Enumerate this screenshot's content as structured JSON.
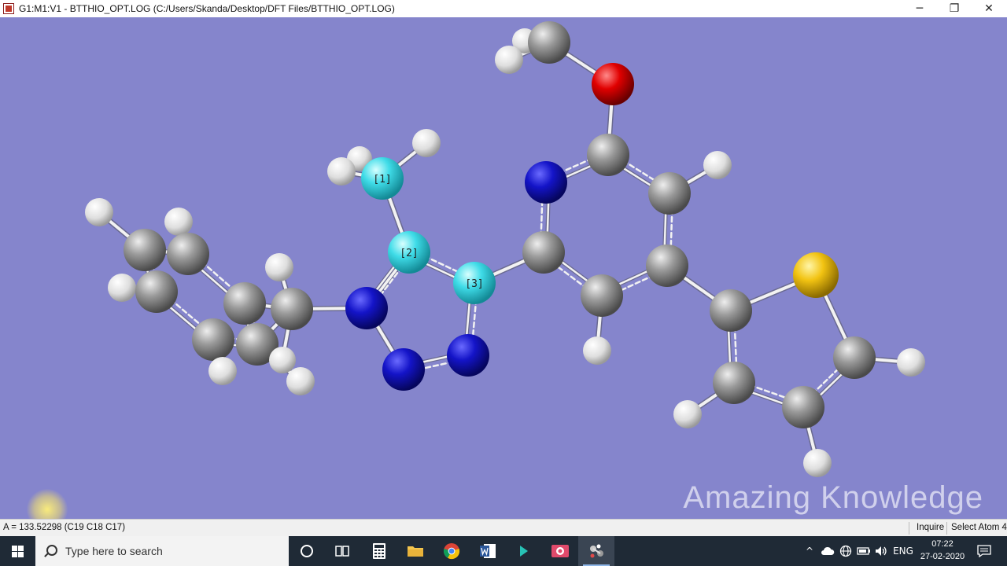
{
  "window": {
    "title": "G1:M1:V1 - BTTHIO_OPT.LOG (C:/Users/Skanda/Desktop/DFT Files/BTTHIO_OPT.LOG)",
    "icon": "gaussview-app-icon",
    "controls": {
      "minimize": "─",
      "restore": "❐",
      "close": "✕"
    }
  },
  "viewer": {
    "background_color": "#8585cc",
    "watermark": "Amazing Knowledge",
    "atom_colors": {
      "carbon": "#8a8a8a",
      "hydrogen": "#e8e8e8",
      "nitrogen": "#1414b4",
      "oxygen": "#d40000",
      "sulfur": "#f2c312",
      "selected": "#3fdce8"
    },
    "selection_labels": [
      "[1]",
      "[2]",
      "[3]"
    ]
  },
  "statusbar": {
    "measurement": "A = 133.52298 (C19 C18 C17)",
    "mode": "Inquire",
    "action": "Select Atom 4"
  },
  "taskbar": {
    "search_placeholder": "Type here to search",
    "apps": [
      "cortana-icon",
      "task-view-icon",
      "calculator-icon",
      "file-explorer-icon",
      "chrome-icon",
      "word-icon",
      "app-arrow-icon",
      "media-app-icon",
      "gaussview-icon"
    ],
    "tray": {
      "chevron": "^",
      "language": "ENG",
      "time": "07:22",
      "date": "27-02-2020"
    }
  }
}
